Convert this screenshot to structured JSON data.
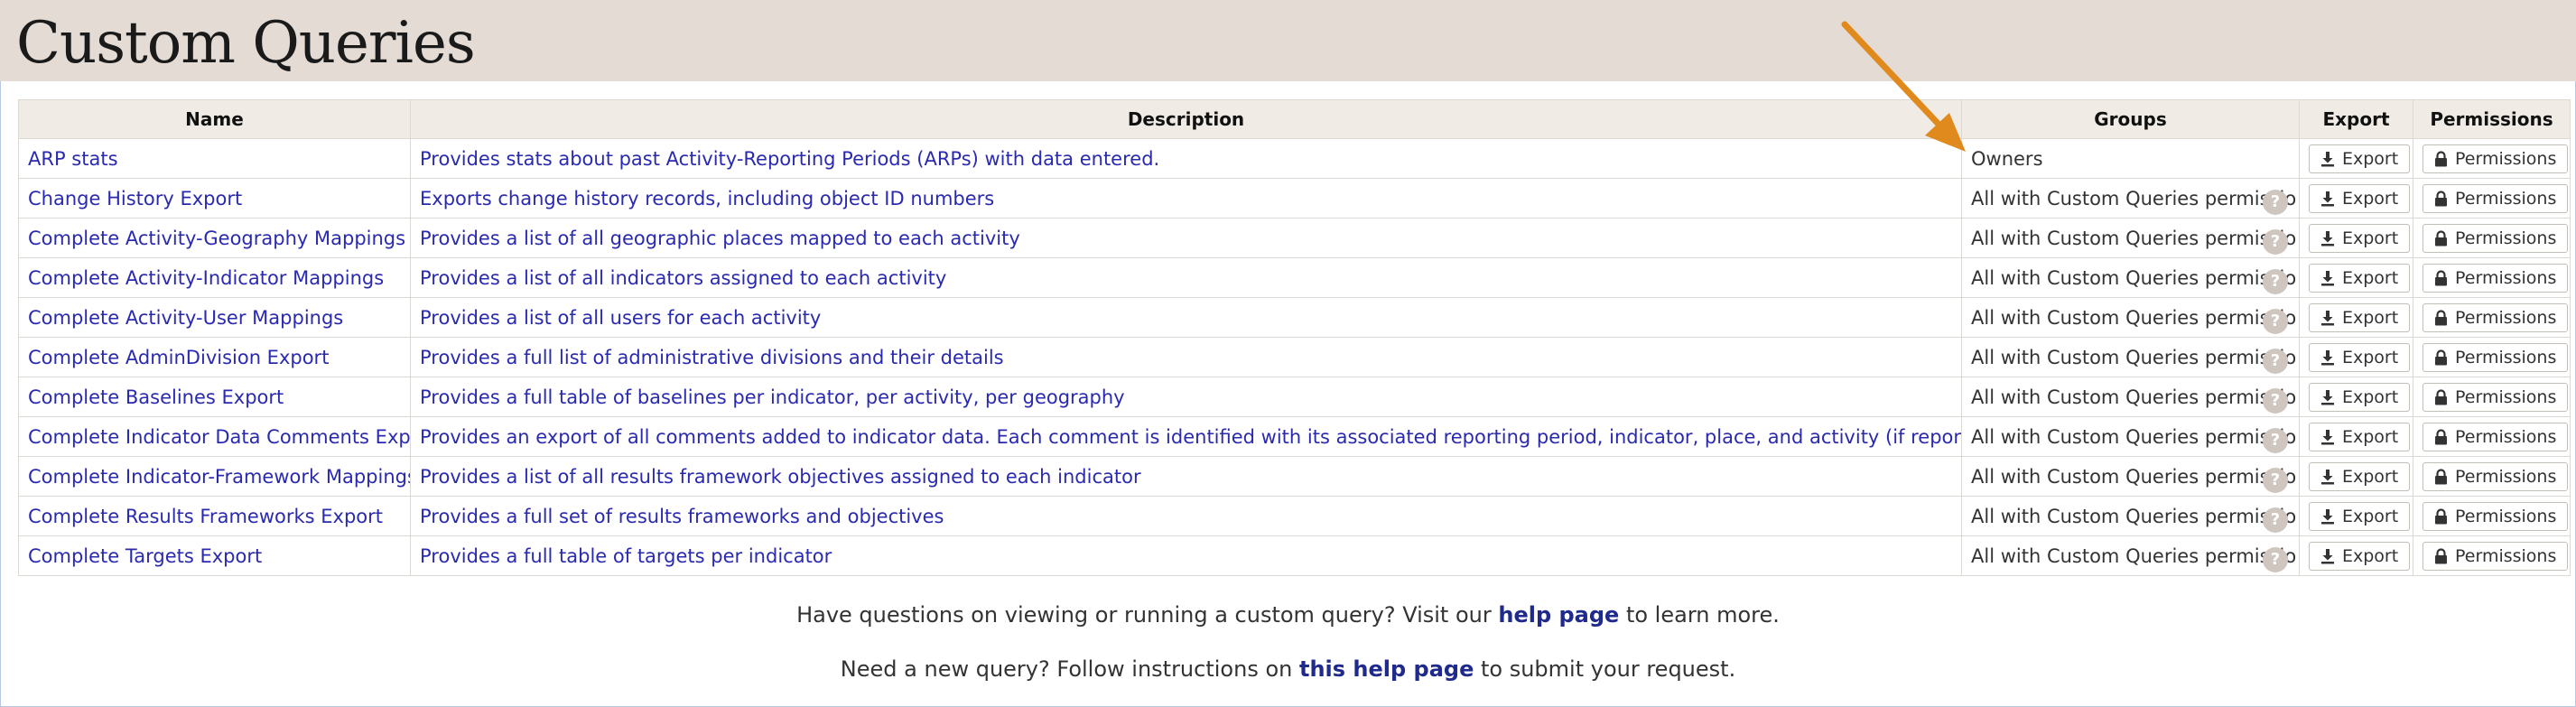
{
  "page": {
    "title": "Custom Queries"
  },
  "table": {
    "headers": {
      "name": "Name",
      "description": "Description",
      "groups": "Groups",
      "export": "Export",
      "permissions": "Permissions"
    },
    "rows": [
      {
        "name": "ARP stats",
        "description": "Provides stats about past Activity-Reporting Periods (ARPs) with data entered.",
        "groups": "Owners",
        "show_help": false
      },
      {
        "name": "Change History Export",
        "description": "Exports change history records, including object ID numbers",
        "groups": "All with Custom Queries permissio",
        "show_help": true
      },
      {
        "name": "Complete Activity-Geography Mappings",
        "description": "Provides a list of all geographic places mapped to each activity",
        "groups": "All with Custom Queries permissio",
        "show_help": true
      },
      {
        "name": "Complete Activity-Indicator Mappings",
        "description": "Provides a list of all indicators assigned to each activity",
        "groups": "All with Custom Queries permissio",
        "show_help": true
      },
      {
        "name": "Complete Activity-User Mappings",
        "description": "Provides a list of all users for each activity",
        "groups": "All with Custom Queries permissio",
        "show_help": true
      },
      {
        "name": "Complete AdminDivision Export",
        "description": "Provides a full list of administrative divisions and their details",
        "groups": "All with Custom Queries permissio",
        "show_help": true
      },
      {
        "name": "Complete Baselines Export",
        "description": "Provides a full table of baselines per indicator, per activity, per geography",
        "groups": "All with Custom Queries permissio",
        "show_help": true
      },
      {
        "name": "Complete Indicator Data Comments Export",
        "description": "Provides an export of all comments added to indicator data. Each comment is identified with its associated reporting period, indicator, place, and activity (if reported per activity).",
        "groups": "All with Custom Queries permissio",
        "show_help": true
      },
      {
        "name": "Complete Indicator-Framework Mappings",
        "description": "Provides a list of all results framework objectives assigned to each indicator",
        "groups": "All with Custom Queries permissio",
        "show_help": true
      },
      {
        "name": "Complete Results Frameworks Export",
        "description": "Provides a full set of results frameworks and objectives",
        "groups": "All with Custom Queries permissio",
        "show_help": true
      },
      {
        "name": "Complete Targets Export",
        "description": "Provides a full table of targets per indicator",
        "groups": "All with Custom Queries permissio",
        "show_help": true
      }
    ],
    "export_label": "Export",
    "permissions_label": "Permissions",
    "help_glyph": "?"
  },
  "footer": {
    "line1": {
      "before": "Have questions on viewing or running a custom query? Visit our ",
      "link": "help page",
      "after": " to learn more."
    },
    "line2": {
      "before": "Need a new query? Follow instructions on ",
      "link": "this help page",
      "after": " to submit your request."
    }
  },
  "icons": {
    "export": "download-icon",
    "permissions": "lock-icon",
    "help": "question-icon",
    "annotation": "arrow-annotation"
  },
  "colors": {
    "header_band": "#e3dbd4",
    "table_header": "#f0ebe5",
    "link": "#2a2ab0",
    "footer_link": "#1f2a8c",
    "arrow": "#e08a1e",
    "help_icon": "#cfc7bf"
  }
}
